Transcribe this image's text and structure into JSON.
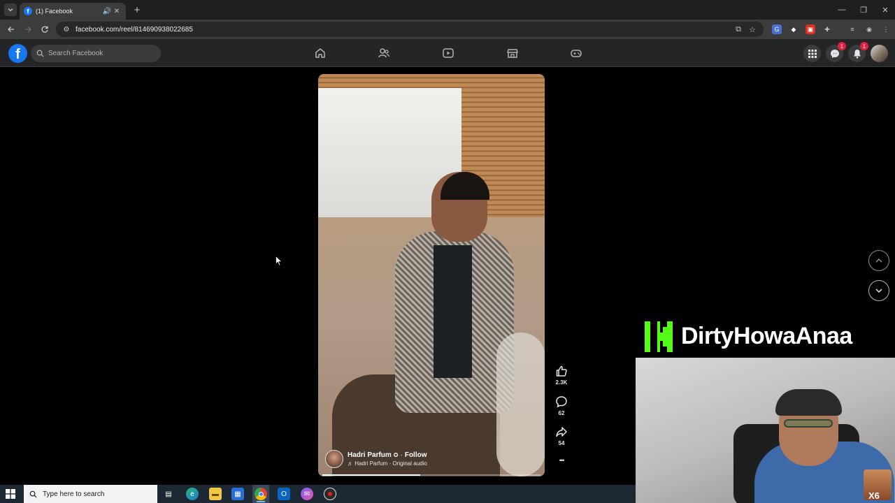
{
  "browser": {
    "tab_title": "(1) Facebook",
    "url": "facebook.com/reel/814690938022685",
    "favicon_letter": "f"
  },
  "facebook": {
    "logo_letter": "f",
    "search_placeholder": "Search Facebook",
    "nav_icons": [
      "home-icon",
      "friends-icon",
      "watch-icon",
      "marketplace-icon",
      "gaming-icon"
    ],
    "messenger_badge": "1",
    "notifications_badge": "1"
  },
  "reel": {
    "author": "Hadri Parfum",
    "separator": "·",
    "follow_label": "Follow",
    "audio_label": "♬ Hadri Parfum · Original audio",
    "progress": 0.45,
    "likes": "2.3K",
    "comments": "62",
    "shares": "54",
    "more_label": "•••"
  },
  "stream_overlay": {
    "channel_name": "DirtyHowaAnaa",
    "sticker_text": "X6"
  },
  "taskbar": {
    "search_placeholder": "Type here to search"
  },
  "colors": {
    "facebook_blue": "#1877f2",
    "kick_green": "#53fc18",
    "badge_red": "#e41e3f"
  }
}
